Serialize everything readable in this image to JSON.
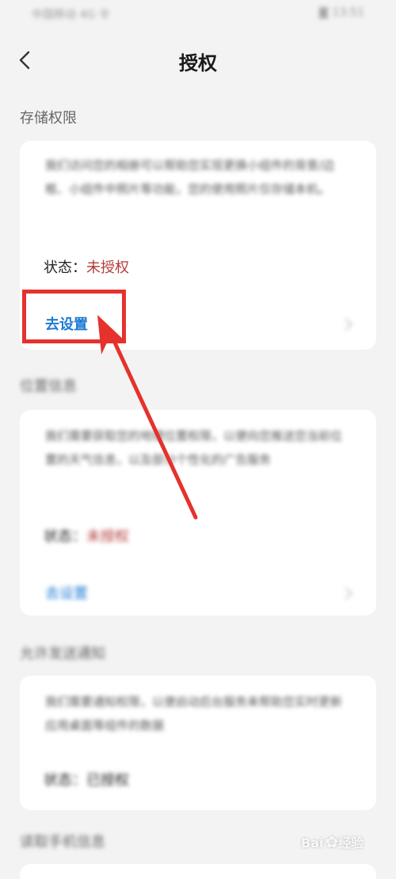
{
  "status_bar": {
    "carrier": "中国移动 4G 令",
    "battery": "◙ 13:51"
  },
  "header": {
    "title": "授权"
  },
  "sections": [
    {
      "title": "存储权限",
      "description": "我们访问您的相册可以帮助您实现更换小组件的背景/边框、小组件中照片等功能，您的使用照片仅存储本机。",
      "status_label": "状态：",
      "status_value": "未授权",
      "action_label": "去设置"
    },
    {
      "title": "位置信息",
      "description": "我们需要获取您的地理位置权限，以便向您推送您当前位置的天气信息，以及部分个性化的广告服务",
      "status_label": "状态：",
      "status_value": "未授权",
      "action_label": "去设置"
    },
    {
      "title": "允许发送通知",
      "description": "我们需要通知权限，以便启动后台服务来帮助您实时更新应用桌面等组件的数据",
      "status_label": "状态：",
      "status_value": "已授权"
    },
    {
      "title": "读取手机信息"
    }
  ],
  "watermark": {
    "text": "Bai",
    "icon": "paw-icon",
    "suffix": "经验"
  },
  "colors": {
    "accent": "#1e7ad4",
    "unauthorized": "#b23a3a",
    "annotation": "#e5322d"
  }
}
